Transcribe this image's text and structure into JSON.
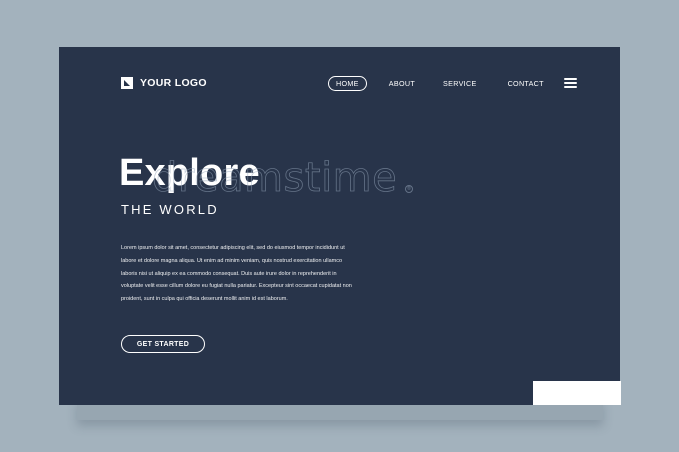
{
  "logo": {
    "text": "YOUR LOGO",
    "icon": "logo-mark-icon"
  },
  "nav": {
    "items": [
      {
        "label": "HOME",
        "active": true
      },
      {
        "label": "ABOUT"
      },
      {
        "label": "SERVICE"
      },
      {
        "label": "CONTACT"
      }
    ],
    "menu_icon": "hamburger-menu-icon"
  },
  "hero": {
    "title": "Explore",
    "subtitle": "THE WORLD",
    "body": "Lorem ipsum dolor sit amet, consectetur adipiscing elit, sed do eiusmod tempor incididunt ut labore et dolore magna aliqua. Ut enim ad minim veniam, quis nostrud exercitation ullamco laboris nisi ut aliquip ex ea commodo consequat. Duis aute irure dolor in reprehenderit in voluptate velit esse cillum dolore eu fugiat nulla pariatur. Excepteur sint occaecat cupidatat non proident, sunt in culpa qui officia deserunt mollit anim id est laborum.",
    "cta_label": "GET STARTED"
  },
  "watermark": {
    "text": "dreamstime",
    "mark": "®"
  },
  "colors": {
    "background": "#a3b2bd",
    "card": "#28344a",
    "text": "#ffffff"
  }
}
